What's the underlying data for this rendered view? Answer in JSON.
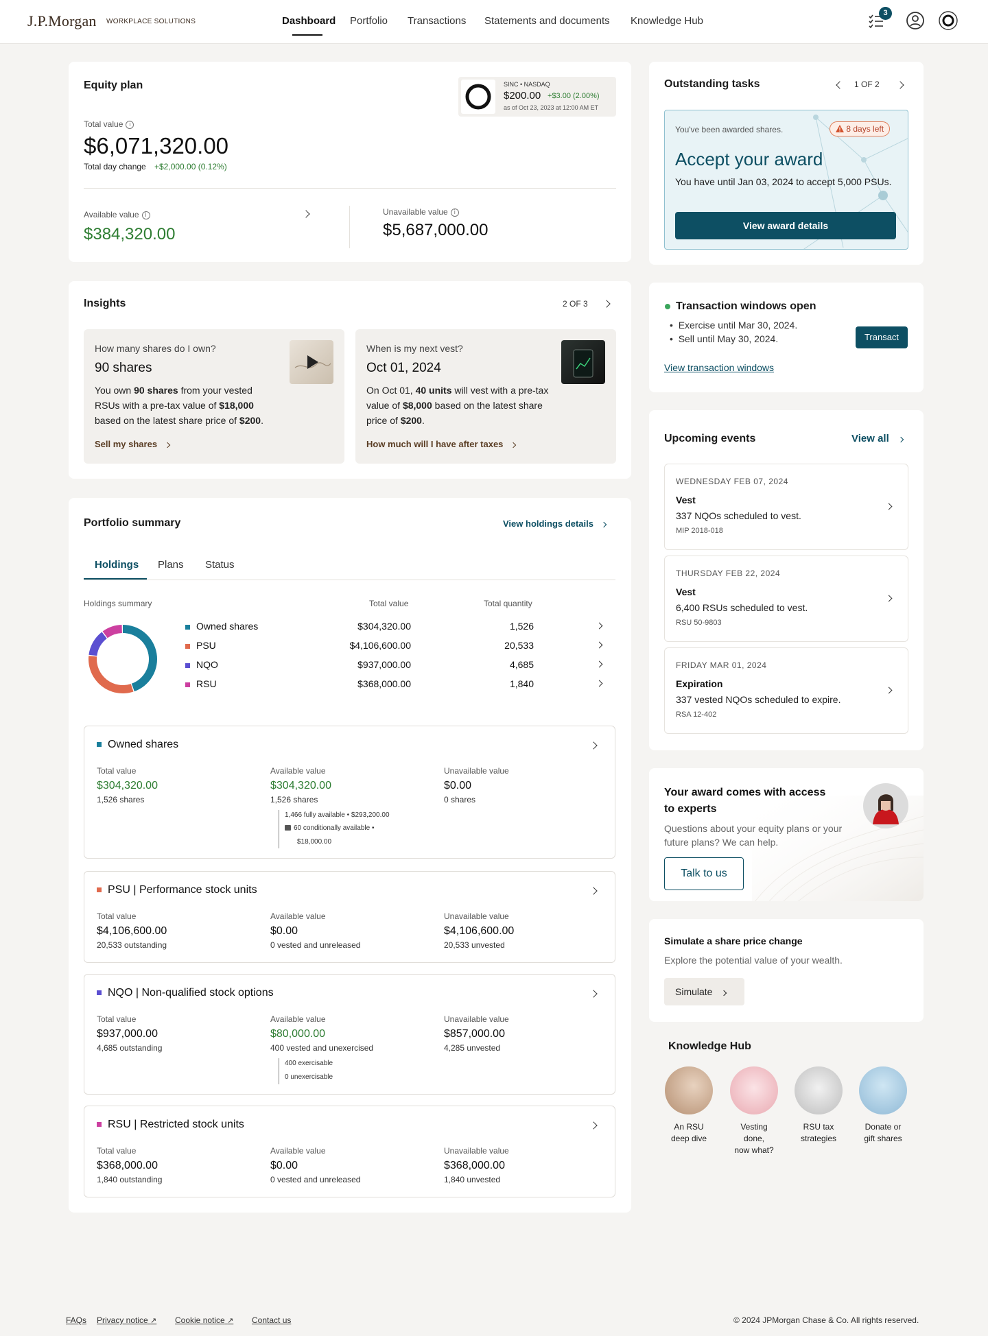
{
  "header": {
    "logo": "J.P.Morgan",
    "logo_sub": "WORKPLACE SOLUTIONS",
    "nav": [
      "Dashboard",
      "Portfolio",
      "Transactions",
      "Statements and documents",
      "Knowledge Hub"
    ],
    "tasks_badge": "3",
    "icons": [
      "tasks-icon",
      "profile-icon",
      "ring-logo-icon"
    ]
  },
  "equity": {
    "title": "Equity plan",
    "ticker": "SINC • NASDAQ",
    "price": "$200.00",
    "change": "+$3.00 (2.00%)",
    "asof": "as of Oct 23, 2023 at 12:00 AM ET",
    "total_label": "Total value",
    "total": "$6,071,320.00",
    "day_change_label": "Total day change",
    "day_change": "+$2,000.00 (0.12%)",
    "avail_label": "Available value",
    "avail": "$384,320.00",
    "unavail_label": "Unavailable value",
    "unavail": "$5,687,000.00"
  },
  "insights": {
    "title": "Insights",
    "pager": "2 OF 3",
    "cards": [
      {
        "q": "How many shares do I own?",
        "a": "90 shares",
        "t1": "You own ",
        "b1": "90 shares",
        "t2": " from your vested RSUs with a pre-tax value of ",
        "b2": "$18,000",
        "t3": " based on the latest share price of ",
        "b3": "$200",
        "t4": ".",
        "link": "Sell my shares"
      },
      {
        "q": "When is my next vest?",
        "a": "Oct 01, 2024",
        "t1": "On Oct 01, ",
        "b1": "40 units",
        "t2": " will vest with a pre-tax value of ",
        "b2": "$8,000",
        "t3": " based on the latest share price of ",
        "b3": "$200",
        "t4": ".",
        "link": "How much will I have after taxes"
      }
    ]
  },
  "portfolio": {
    "title": "Portfolio summary",
    "view_link": "View holdings details",
    "tabs": [
      "Holdings",
      "Plans",
      "Status"
    ],
    "holdings_label": "Holdings summary",
    "col_total": "Total value",
    "col_qty": "Total quantity",
    "rows": [
      {
        "name": "Owned shares",
        "total": "$304,320.00",
        "qty": "1,526",
        "color": "#1a7f9c"
      },
      {
        "name": "PSU",
        "total": "$4,106,600.00",
        "qty": "20,533",
        "color": "#e06a4d"
      },
      {
        "name": "NQO",
        "total": "$937,000.00",
        "qty": "4,685",
        "color": "#5b4fd1"
      },
      {
        "name": "RSU",
        "total": "$368,000.00",
        "qty": "1,840",
        "color": "#cc3fa0"
      }
    ],
    "cards": [
      {
        "title": "Owned shares",
        "tv": "$304,320.00",
        "ts": "1,526 shares",
        "av": "$304,320.00",
        "as": "1,526 shares",
        "uv": "$0.00",
        "us": "0 shares",
        "n1": "1,466 fully available • $293,200.00",
        "n2": "60 conditionally available •",
        "n3": "$18,000.00"
      },
      {
        "title": "PSU | Performance stock units",
        "tv": "$4,106,600.00",
        "ts": "20,533 outstanding",
        "av": "$0.00",
        "as": "0 vested and unreleased",
        "uv": "$4,106,600.00",
        "us": "20,533 unvested"
      },
      {
        "title": "NQO | Non-qualified stock options",
        "tv": "$937,000.00",
        "ts": "4,685 outstanding",
        "av": "$80,000.00",
        "as": "400 vested and unexercised",
        "uv": "$857,000.00",
        "us": "4,285 unvested",
        "n1": "400 exercisable",
        "n2": "0 unexercisable"
      },
      {
        "title": "RSU | Restricted stock units",
        "tv": "$368,000.00",
        "ts": "1,840 outstanding",
        "av": "$0.00",
        "as": "0 vested and unreleased",
        "uv": "$368,000.00",
        "us": "1,840 unvested"
      }
    ],
    "col_labels": [
      "Total value",
      "Available value",
      "Unavailable value"
    ]
  },
  "tasks": {
    "title": "Outstanding tasks",
    "pager": "1 OF 2",
    "awarded": "You've been awarded shares.",
    "days": "8 days left",
    "heading": "Accept your award",
    "text": "You have until Jan 03, 2024 to accept 5,000 PSUs.",
    "button": "View award details"
  },
  "windows": {
    "title": "Transaction windows open",
    "items": [
      "Exercise until Mar 30, 2024.",
      "Sell until May 30, 2024."
    ],
    "button": "Transact",
    "link": "View transaction windows"
  },
  "events": {
    "title": "Upcoming events",
    "view_all": "View all",
    "items": [
      {
        "date": "WEDNESDAY FEB 07, 2024",
        "kind": "Vest",
        "text": "337 NQOs scheduled to vest.",
        "code": "MIP 2018-018"
      },
      {
        "date": "THURSDAY FEB 22, 2024",
        "kind": "Vest",
        "text": "6,400 RSUs scheduled to vest.",
        "code": "RSU 50-9803"
      },
      {
        "date": "FRIDAY MAR 01, 2024",
        "kind": "Expiration",
        "text": "337 vested NQOs scheduled to expire.",
        "code": "RSA 12-402"
      }
    ]
  },
  "experts": {
    "title": "Your award comes with access to experts",
    "text": "Questions about your equity plans or your future plans? We can help.",
    "button": "Talk to us"
  },
  "simulate": {
    "title": "Simulate a share price change",
    "text": "Explore the potential value of your wealth.",
    "button": "Simulate"
  },
  "knowledge": {
    "title": "Knowledge Hub",
    "items": [
      {
        "l1": "An RSU",
        "l2": "deep dive"
      },
      {
        "l1": "Vesting done,",
        "l2": "now what?"
      },
      {
        "l1": "RSU tax",
        "l2": "strategies"
      },
      {
        "l1": "Donate or",
        "l2": "gift shares"
      }
    ]
  },
  "footer": {
    "links": [
      "FAQs",
      "Privacy notice",
      "Cookie notice",
      "Contact us"
    ],
    "copyright": "© 2024 JPMorgan Chase & Co. All rights reserved."
  }
}
